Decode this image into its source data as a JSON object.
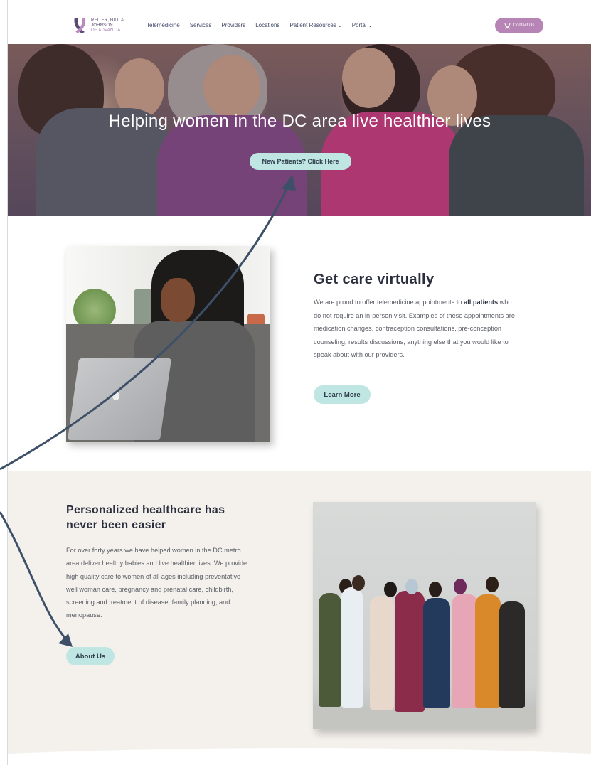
{
  "header": {
    "logo_line1": "REITER, HILL &",
    "logo_line2": "JOHNSON",
    "logo_line3": "OF ADVANTIA",
    "nav": [
      {
        "label": "Telemedicine",
        "has_dropdown": false
      },
      {
        "label": "Services",
        "has_dropdown": false
      },
      {
        "label": "Providers",
        "has_dropdown": false
      },
      {
        "label": "Locations",
        "has_dropdown": false
      },
      {
        "label": "Patient Resources",
        "has_dropdown": true
      },
      {
        "label": "Portal",
        "has_dropdown": true
      }
    ],
    "contact_label": "Contact Us"
  },
  "hero": {
    "title": "Helping women in the DC area live healthier lives",
    "button_label": "New Patients? Click Here"
  },
  "virtual": {
    "title": "Get care virtually",
    "text_before": "We are proud to offer telemedicine appointments to ",
    "text_bold": "all patients",
    "text_after": " who do not require an in-person visit. Examples of these appointments are medication changes, contraception consultations, pre-conception counseling, results discussions, anything else that you would like to speak about with our providers.",
    "button_label": "Learn More"
  },
  "personalized": {
    "title": "Personalized healthcare has never been easier",
    "text": "For over forty years we have helped women in the DC metro  area deliver healthy babies and live healthier lives. We provide high quality care to women of all ages including preventative well woman care, pregnancy and prenatal care, childbirth, screening and treatment of disease, family planning, and menopause.",
    "button_label": "About Us"
  },
  "colors": {
    "accent_button": "#bfe6e2",
    "contact_button": "#b784b6",
    "section_bg": "#f4f1ec",
    "annotation_arrow": "#3d5068"
  }
}
